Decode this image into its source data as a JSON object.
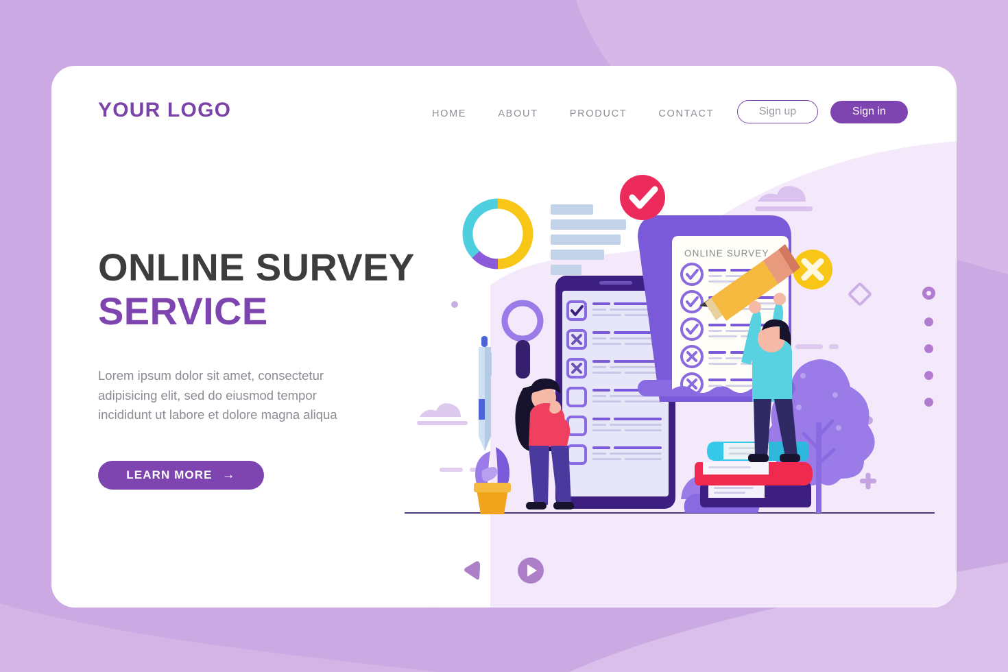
{
  "page": {
    "background_color": "#c9a7e0",
    "card_color": "#ffffff",
    "accent_purple": "#7e45b0",
    "heading_dark": "#3d3d40",
    "text_gray": "#8b8b93"
  },
  "header": {
    "logo": "YOUR LOGO",
    "nav": [
      {
        "label": "HOME"
      },
      {
        "label": "ABOUT"
      },
      {
        "label": "PRODUCT"
      },
      {
        "label": "CONTACT"
      }
    ],
    "signup_label": "Sign up",
    "signin_label": "Sign in"
  },
  "hero": {
    "title_line1": "ONLINE SURVEY",
    "title_line2": "SERVICE",
    "description": "Lorem ipsum dolor sit amet, consectetur adipisicing elit, sed do eiusmod tempor incididunt ut labore et dolore magna aliqua",
    "cta_label": "LEARN MORE",
    "cta_arrow": "→"
  },
  "illustration": {
    "survey_card_title": "ONLINE SURVEY",
    "survey_card_rows": [
      {
        "state": "check"
      },
      {
        "state": "check"
      },
      {
        "state": "check"
      },
      {
        "state": "cross"
      },
      {
        "state": "cross"
      }
    ],
    "phone_rows": [
      {
        "state": "check"
      },
      {
        "state": "cross"
      },
      {
        "state": "cross"
      },
      {
        "state": "empty"
      },
      {
        "state": "empty"
      },
      {
        "state": "empty"
      }
    ],
    "badges": [
      {
        "name": "check-badge",
        "color": "#ed2a5c",
        "glyph": "check"
      },
      {
        "name": "cross-badge",
        "color": "#f7c616",
        "glyph": "cross"
      }
    ],
    "donut_chart": {
      "segments": [
        {
          "color": "#f7c616",
          "percent": 50
        },
        {
          "color": "#8a5ad8",
          "percent": 13
        },
        {
          "color": "#4ecfe0",
          "percent": 37
        }
      ]
    },
    "bar_chart": {
      "color": "#c3d4ea",
      "widths": [
        62,
        110,
        102,
        78,
        45
      ]
    },
    "books": [
      {
        "color": "#35c8e8"
      },
      {
        "color": "#f0294f"
      },
      {
        "color": "#3d1f82"
      }
    ],
    "people": [
      {
        "name": "woman",
        "top_color": "#ef4060",
        "pants_color": "#4b3a9e",
        "hair_color": "#17132c"
      },
      {
        "name": "man",
        "top_color": "#58d2e0",
        "pants_color": "#2f2a63",
        "hair_color": "#17132c"
      }
    ],
    "pencil_color": "#f5b940",
    "tree_color": "#9b7be8"
  },
  "carousel": {
    "prev_label": "previous slide",
    "next_label": "next slide",
    "dots": [
      {
        "active": true
      },
      {
        "active": false
      },
      {
        "active": false
      },
      {
        "active": false
      },
      {
        "active": false
      }
    ]
  }
}
